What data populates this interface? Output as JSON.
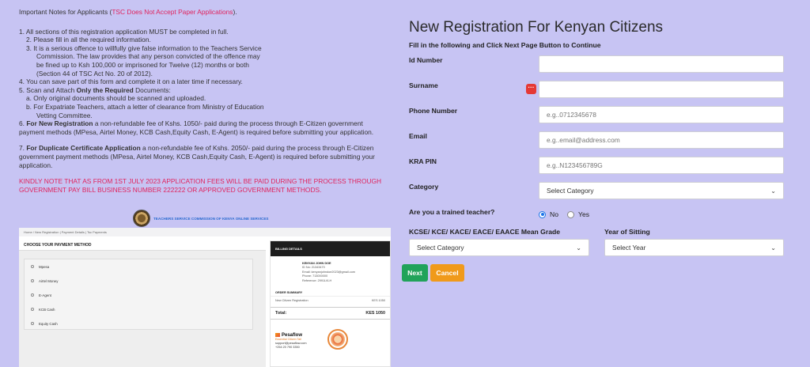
{
  "notes": {
    "title_prefix": "Important Notes for Applicants (",
    "title_red": "TSC Does Not Accept Paper Applications",
    "title_suffix": ").",
    "item1": "1.  All sections of this registration application MUST be completed in full.",
    "item2": "2.  Please fill in all the required information.",
    "item3_l1": "3.  It is a serious offence to willfully give false information to the Teachers Service",
    "item3_l2": "Commission. The law provides that any person convicted of the offence may",
    "item3_l3": "be fined up to Ksh 100,000 or imprisoned for Twelve (12) months or both",
    "item3_l4": "(Section 44 of TSC Act No. 20 of 2012).",
    "item4": "4.  You can save part of this form and complete it on a later time if necessary.",
    "item5_prefix": "5.  Scan and Attach ",
    "item5_bold": "Only the  Required",
    "item5_suffix": " Documents:",
    "item5a": "a. Only original documents should be scanned and uploaded.",
    "item5b_l1": "b. For Expatriate Teachers, attach a letter of clearance from Ministry of Education",
    "item5b_l2": "Vetting Committee.",
    "item6_prefix": "6.  ",
    "item6_bold": "For New Registration",
    "item6_l1": " a non-refundable fee of Kshs. 1050/- paid during the process through E-Citizen government",
    "item6_l2": "payment methods (MPesa, Airtel Money, KCB Cash,Equity Cash, E-Agent) is required before submitting your application.",
    "item7_prefix": "7.  ",
    "item7_bold": "For Duplicate Certificate Application",
    "item7_l1": " a non-refundable fee of Kshs. 2050/- paid during the process through E-Citizen",
    "item7_l2": "government payment methods (MPesa, Airtel Money, KCB Cash,Equity Cash, E-Agent) is required before submitting your",
    "item7_l3": "application.",
    "notice_l1": "KINDLY NOTE THAT AS FROM 1ST JULY 2023 APPLICATION FEES WILL BE PAID DURING THE PROCESS THROUGH",
    "notice_l2": "GOVERNMENT PAY BILL BUSINESS NUMBER 222222 OR APPROVED GOVERNMENT METHODS."
  },
  "embedded": {
    "header_title": "TEACHERS SERVICE COMMISSION OF KENYA ONLINE SERVICES",
    "breadcrumb": "Home  /  New Registration | Payment Details | Tsc Payments",
    "payment_title": "CHOOSE YOUR PAYMENT METHOD",
    "options": [
      "Mpesa",
      "Airtel Money",
      "E-Agent",
      "KCB Cash",
      "Equity Cash"
    ],
    "billing_title": "BILLING DETAILS",
    "bill_name": "KENYAN JOHN DOE",
    "bill_id": "ID No: 21343470",
    "bill_email": "Email: kenyanjohndoe2023@gmail.com",
    "bill_phone": "Phone: 713000000",
    "bill_ref": "Reference: 2991LVLH",
    "order_summary": "ORDER SUMMARY",
    "order_item": "New Citizen Registration",
    "order_amount": "KES 1050",
    "total_label": "Total:",
    "total_value": "KES 1050",
    "pesaflow_name": "Pesaflow",
    "pesaflow_tag": "Essential Citizen Tail",
    "pesaflow_email": "support@pesaflow.com",
    "pesaflow_phone": "+254 20 790 3350"
  },
  "form": {
    "title": "New Registration For Kenyan Citizens",
    "subtitle": "Fill in the following and Click Next Page Button to Continue",
    "id_label": "Id Number",
    "id_value": "",
    "surname_label": "Surname",
    "surname_value": "",
    "phone_label": "Phone Number",
    "phone_placeholder": "e.g..0712345678",
    "email_label": "Email",
    "email_placeholder": "e.g..email@address.com",
    "kra_label": "KRA PIN",
    "kra_placeholder": "e.g..N123456789G",
    "category_label": "Category",
    "category_value": "Select Category",
    "trained_label": "Are you a trained teacher?",
    "trained_no": "No",
    "trained_yes": "Yes",
    "trained_selected": "No",
    "grade_label": "KCSE/ KCE/ KACE/ EACE/ EAACE Mean Grade",
    "grade_value": "Select Category",
    "year_label": "Year of Sitting",
    "year_value": "Select Year",
    "next_label": "Next",
    "cancel_label": "Cancel"
  },
  "colors": {
    "background": "#c7c4f3",
    "accent_red": "#e0245e",
    "next_button": "#21a35a",
    "cancel_button": "#f09a1a"
  }
}
